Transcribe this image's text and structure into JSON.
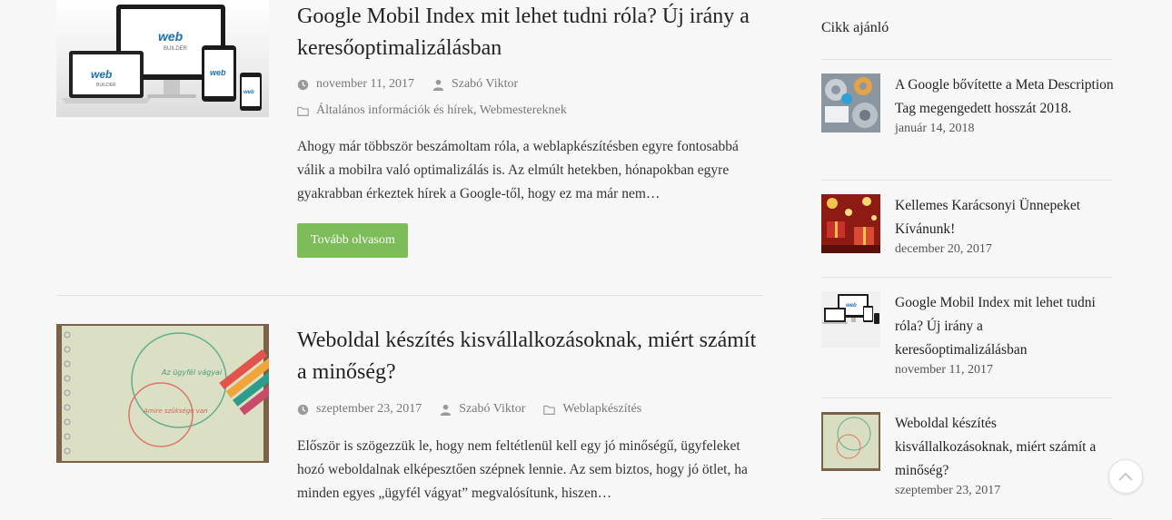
{
  "posts": [
    {
      "title": "Google Mobil Index mit lehet tudni róla? Új irány a keresőoptimalizálásban",
      "date": "november 11, 2017",
      "author": "Szabó Viktor",
      "categories": [
        "Általános információk és hírek",
        "Webmestereknek"
      ],
      "category_separator": ", ",
      "excerpt": "Ahogy már többször beszámoltam róla, a weblapkészítésben egyre fontosabbá válik a mobilra való optimalizálás is. Az elmúlt hetekben, hónapokban egyre gyakrabban érkeztek hírek a Google-től, hogy ez ma már nem…",
      "read_more": "Tovább olvasom",
      "thumb_brand_1": "web",
      "thumb_brand_2": "BUILDER"
    },
    {
      "title": "Weboldal készítés kisvállalkozásoknak, miért számít a minőség?",
      "date": "szeptember 23, 2017",
      "author": "Szabó Viktor",
      "categories": [
        "Weblapkészítés"
      ],
      "excerpt": "Először is szögezzük le, hogy nem feltétlenül kell egy jó minőségű, ügyfeleket hozó weboldalnak elképesztően szépnek lennie. Az sem biztos, hogy jó ötlet, ha minden egyes „ügyfél vágyat” megvalósítunk, hiszen…",
      "thumb_label_1": "Az ügyfél vágyai",
      "thumb_label_2": "Amire szüksége van"
    }
  ],
  "sidebar": {
    "title": "Cikk ajánló",
    "items": [
      {
        "title": "A Google bővítette a Meta Description Tag megengedett hosszát 2018.",
        "date": "január 14, 2018"
      },
      {
        "title": "Kellemes Karácsonyi Ünnepeket Kívánunk!",
        "date": "december 20, 2017"
      },
      {
        "title": "Google Mobil Index mit lehet tudni róla? Új irány a keresőoptimalizálásban",
        "date": "november 11, 2017"
      },
      {
        "title": "Weboldal készítés kisvállalkozásoknak, miért számít a minőség?",
        "date": "szeptember 23, 2017"
      }
    ]
  },
  "colors": {
    "accent_button": "#7cbd5a",
    "meta_icon": "#9a9a9a"
  },
  "icons": {
    "date": "clock-icon",
    "author": "user-icon",
    "category": "folder-icon",
    "scroll_top": "chevron-up-icon"
  }
}
